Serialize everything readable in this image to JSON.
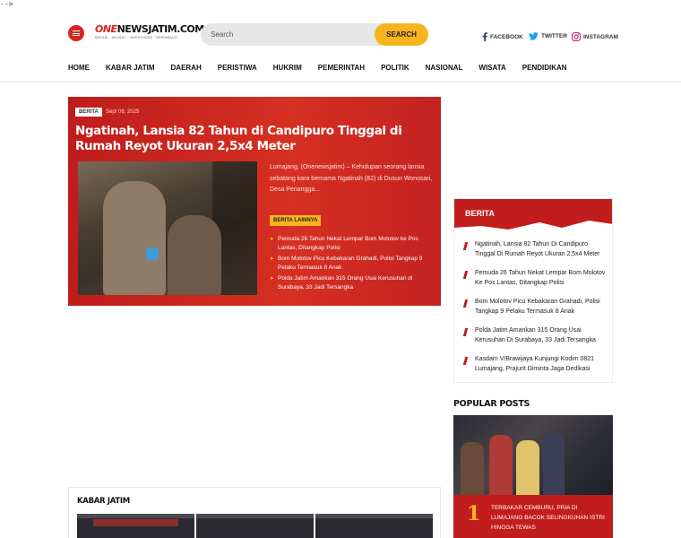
{
  "stray_text": "-->",
  "header": {
    "logo_one": "ONE",
    "logo_rest": "NEWSJATIM.COM",
    "logo_tagline": "BERANI · AKURAT · INDEPENDEN · BERIMBANG",
    "search_placeholder": "Search",
    "search_button": "SEARCH",
    "social": [
      {
        "label": "FACEBOOK",
        "icon": "facebook-icon"
      },
      {
        "label": "TWITTER",
        "icon": "twitter-icon"
      },
      {
        "label": "INSTAGRAM",
        "icon": "instagram-icon"
      }
    ]
  },
  "nav": [
    "HOME",
    "KABAR JATIM",
    "DAERAH",
    "PERISTIWA",
    "HUKRIM",
    "PEMERINTAH",
    "POLITIK",
    "NASIONAL",
    "WISATA",
    "PENDIDIKAN"
  ],
  "hero": {
    "badge": "BERITA",
    "date": "Sept 06, 2025",
    "title": "Ngatinah, Lansia 82 Tahun di Candipuro Tinggal di Rumah Reyot Ukuran 2,5x4 Meter",
    "excerpt": "Lumajang, (Onenewsjatim) – Kehidupan seorang lansia sebatang kara bernama Ngatinah (82) di Dusun Wonosari, Desa Penangga...",
    "more_button": "BERITA LAINNYA",
    "related": [
      "Pemuda 26 Tahun Nekat Lempar Bom Molotov ke Pos Lantas, Ditangkap Polisi",
      "Bom Molotov Picu Kebakaran Grahadi, Polisi Tangkap 9 Pelaku Termasuk 8 Anak",
      "Polda Jatim Amankan 315 Orang Usai Kerusuhan di Surabaya, 33 Jadi Tersangka"
    ]
  },
  "berita_box": {
    "title": "BERITA",
    "items": [
      "Ngatinah, Lansia 82 Tahun Di Candipuro Tinggal Di Rumah Reyot Ukuran 2,5x4 Meter",
      "Pemuda 26 Tahun Nekat Lempar Bom Molotov Ke Pos Lantas, Ditangkap Polisi",
      "Bom Molotov Picu Kebakaran Grahadi, Polisi Tangkap 9 Pelaku Termasuk 8 Anak",
      "Polda Jatim Amankan 315 Orang Usai Kerusuhan Di Surabaya, 33 Jadi Tersangka",
      "Kasdam V/Brawijaya Kunjungi Kodim 0821 Lumajang, Prajurit Diminta Jaga Dedikasi"
    ]
  },
  "popular": {
    "title": "POPULAR POSTS",
    "first_rank": "1",
    "first_title": "TERBAKAR CEMBURU, PRIA DI LUMAJANG BACOK SELINGKUHAN ISTRI HINGGA TEWAS"
  },
  "kabar_jatim": {
    "title": "KABAR JATIM"
  },
  "colors": {
    "brand_red": "#d7261d",
    "accent_yellow": "#f7b51d"
  }
}
